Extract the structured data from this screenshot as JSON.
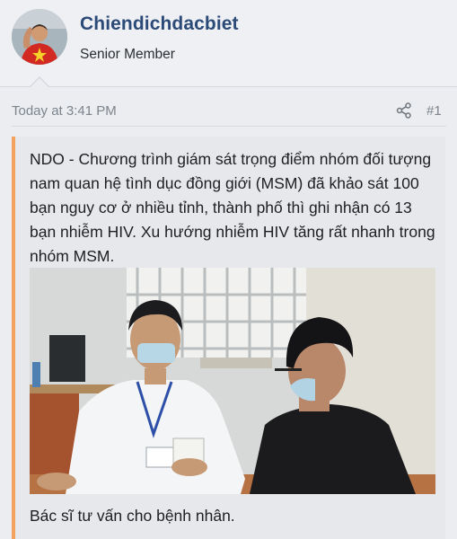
{
  "post": {
    "author": {
      "username": "Chiendichdacbiet",
      "title": "Senior Member",
      "avatar_icon": "user-avatar"
    },
    "meta": {
      "timestamp": "Today at 3:41 PM",
      "share_icon": "share-icon",
      "post_number": "#1"
    },
    "quote": {
      "text": "NDO - Chương trình giám sát trọng điểm nhóm đối tượng nam quan hệ tình dục đồng giới (MSM) đã khảo sát 100 bạn nguy cơ ở nhiều tỉnh, thành phố thì ghi nhận có 13 bạn nhiễm HIV. Xu hướng nhiễm HIV tăng rất nhanh trong nhóm MSM.",
      "caption": "Bác sĩ tư vấn cho bệnh nhân."
    },
    "colors": {
      "username": "#2c4a78",
      "quote_accent": "#f3a25d",
      "meta_text": "#7d848b"
    }
  }
}
